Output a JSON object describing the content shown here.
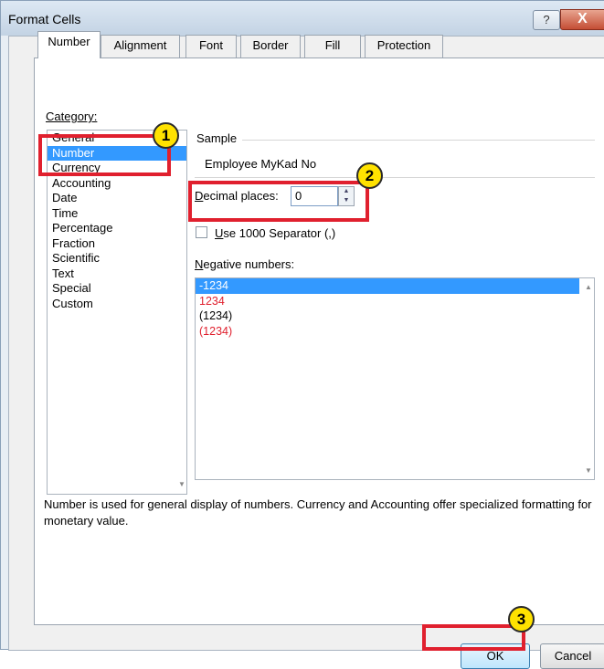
{
  "window": {
    "title": "Format Cells",
    "help": "?",
    "close": "X"
  },
  "tabs": [
    "Number",
    "Alignment",
    "Font",
    "Border",
    "Fill",
    "Protection"
  ],
  "category": {
    "label": "Category:",
    "items": [
      "General",
      "Number",
      "Currency",
      "Accounting",
      "Date",
      "Time",
      "Percentage",
      "Fraction",
      "Scientific",
      "Text",
      "Special",
      "Custom"
    ],
    "selected": "Number"
  },
  "sample": {
    "label": "Sample",
    "value": "Employee MyKad No"
  },
  "decimal": {
    "label": "Decimal places:",
    "value": "0"
  },
  "separator": {
    "label": "Use 1000 Separator (,)",
    "checked": false
  },
  "negative": {
    "label": "Negative numbers:",
    "items": [
      {
        "text": "-1234",
        "color": "#ffffff",
        "selected": true
      },
      {
        "text": "1234",
        "color": "#e0202e",
        "selected": false
      },
      {
        "text": "(1234)",
        "color": "#000000",
        "selected": false
      },
      {
        "text": "(1234)",
        "color": "#e0202e",
        "selected": false
      }
    ]
  },
  "description": "Number is used for general display of numbers.  Currency and Accounting offer specialized formatting for monetary value.",
  "buttons": {
    "ok": "OK",
    "cancel": "Cancel"
  },
  "annotations": {
    "badge1": "1",
    "badge2": "2",
    "badge3": "3",
    "highlight_color": "#e0202e",
    "badge_color": "#ffe200"
  }
}
